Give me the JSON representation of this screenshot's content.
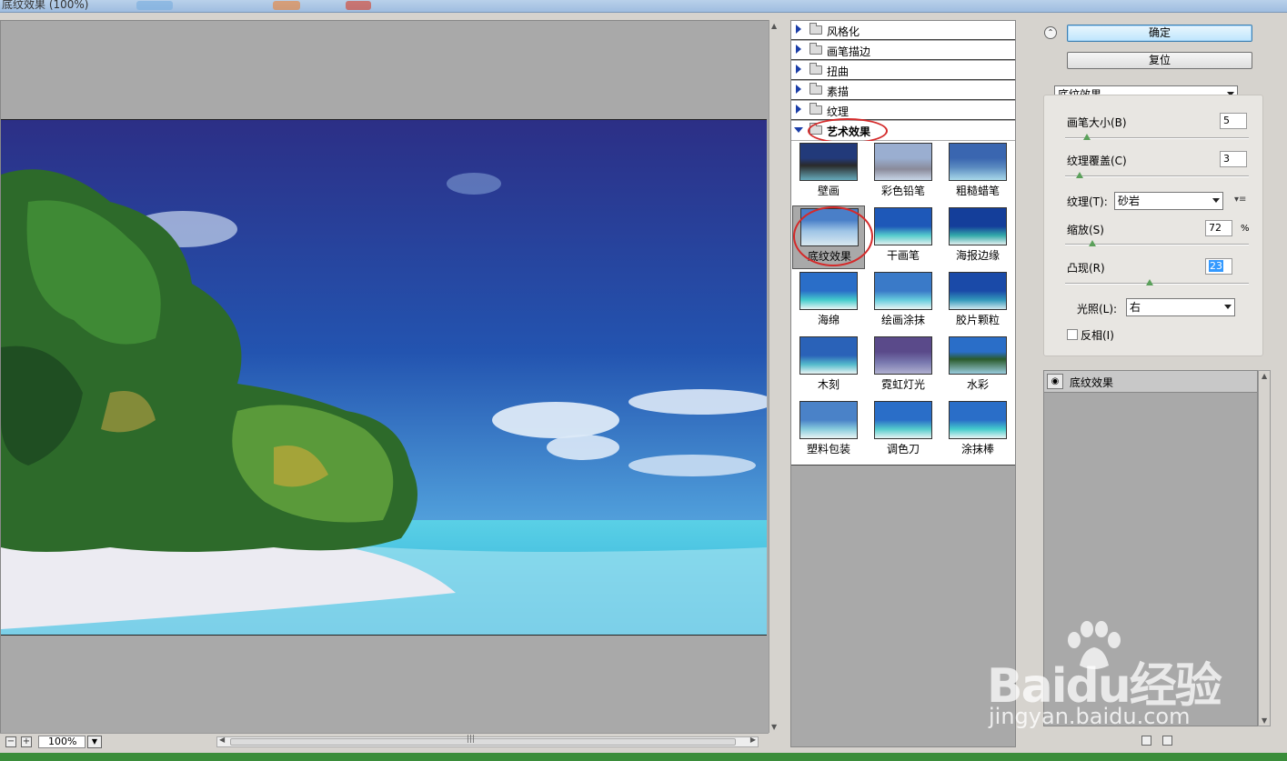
{
  "window": {
    "title": "底纹效果 (100%)"
  },
  "preview": {
    "zoom": "100%",
    "zoom_out": "−",
    "zoom_in": "+"
  },
  "gallery": {
    "categories": [
      {
        "label": "风格化",
        "open": false
      },
      {
        "label": "画笔描边",
        "open": false
      },
      {
        "label": "扭曲",
        "open": false
      },
      {
        "label": "素描",
        "open": false
      },
      {
        "label": "纹理",
        "open": false
      },
      {
        "label": "艺术效果",
        "open": true
      }
    ],
    "filters": [
      "壁画",
      "彩色铅笔",
      "粗糙蜡笔",
      "底纹效果",
      "干画笔",
      "海报边缘",
      "海绵",
      "绘画涂抹",
      "胶片颗粒",
      "木刻",
      "霓虹灯光",
      "水彩",
      "塑料包装",
      "调色刀",
      "涂抹棒"
    ],
    "selected": "底纹效果"
  },
  "settings": {
    "ok_label": "确定",
    "reset_label": "复位",
    "filter_select": "底纹效果",
    "brush_size": {
      "label": "画笔大小(B)",
      "value": "5",
      "fraction": 0.12
    },
    "texture_coverage": {
      "label": "纹理覆盖(C)",
      "value": "3",
      "fraction": 0.08
    },
    "texture": {
      "label": "纹理(T):",
      "value": "砂岩"
    },
    "scaling": {
      "label": "缩放(S)",
      "value": "72",
      "unit": "%",
      "fraction": 0.15
    },
    "relief": {
      "label": "凸现(R)",
      "value": "23",
      "fraction": 0.46
    },
    "light": {
      "label": "光照(L):",
      "value": "右"
    },
    "invert": {
      "label": "反相(I)",
      "checked": false
    }
  },
  "layers": [
    {
      "name": "底纹效果"
    }
  ],
  "watermark": {
    "brand": "Baidu经验",
    "url": "jingyan.baidu.com"
  },
  "colors": {
    "accent": "#1b3ea8",
    "highlight_ring": "#d42a2a",
    "panel": "#d6d3ce",
    "canvas_gray": "#a9a9a9"
  }
}
